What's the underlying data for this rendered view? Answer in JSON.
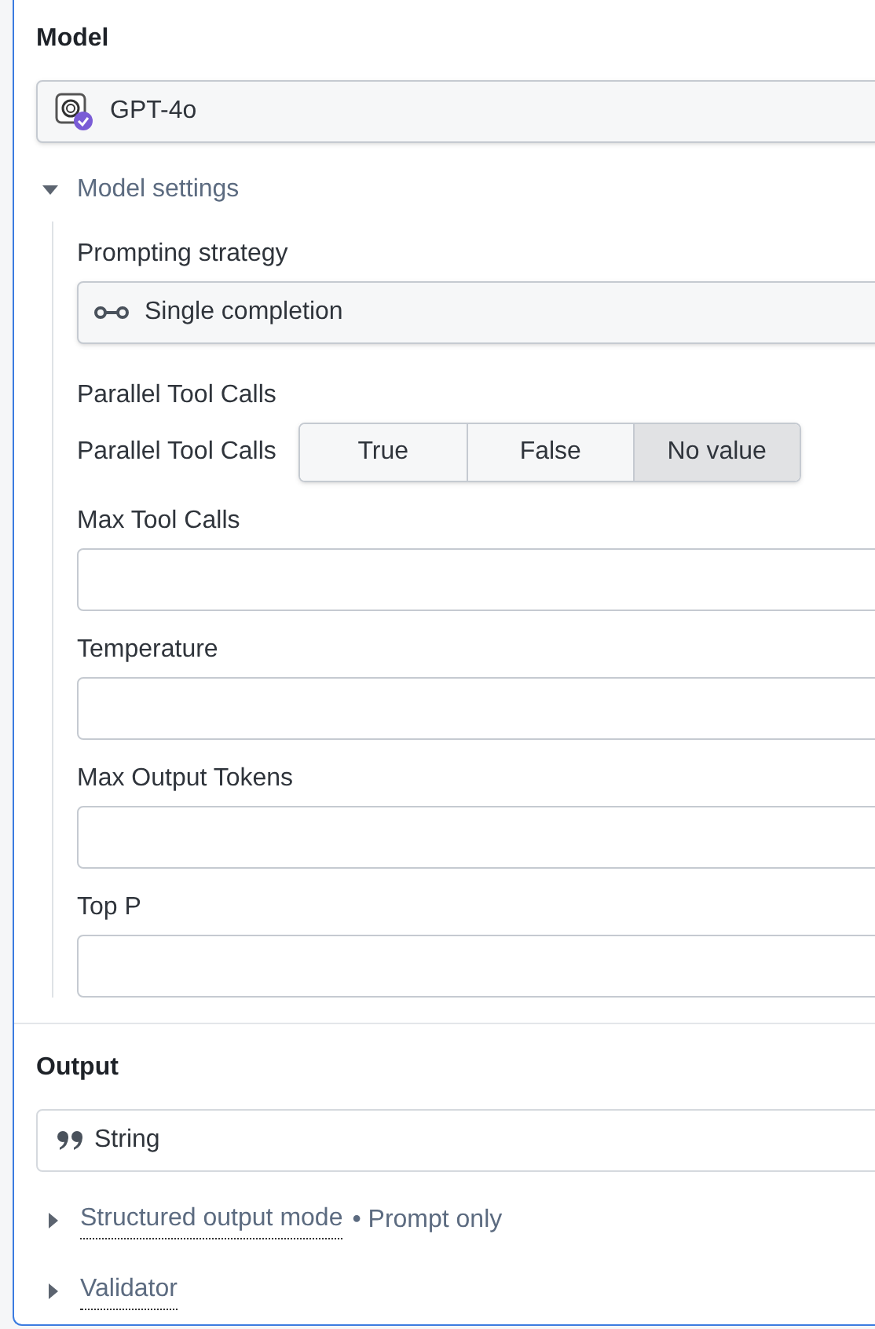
{
  "model": {
    "label": "Model",
    "value": "GPT-4o"
  },
  "model_settings": {
    "label": "Model settings",
    "expanded": true,
    "fields": [
      {
        "kind": "select",
        "label": "Prompting strategy",
        "value": "Single completion"
      },
      {
        "kind": "segmented",
        "label": "Parallel Tool Calls",
        "inline_label": "Parallel Tool Calls",
        "options": [
          {
            "label": "True",
            "selected": false
          },
          {
            "label": "False",
            "selected": false
          },
          {
            "label": "No value",
            "selected": true
          }
        ]
      },
      {
        "kind": "input",
        "label": "Max Tool Calls"
      },
      {
        "kind": "input",
        "label": "Temperature"
      },
      {
        "kind": "input",
        "label": "Max Output Tokens"
      },
      {
        "kind": "input",
        "label": "Top P"
      }
    ]
  },
  "output": {
    "label": "Output",
    "value": "String",
    "sections": [
      {
        "label": "Structured output mode",
        "note": "• Prompt only",
        "expanded": false
      },
      {
        "label": "Validator",
        "expanded": false
      }
    ]
  }
}
